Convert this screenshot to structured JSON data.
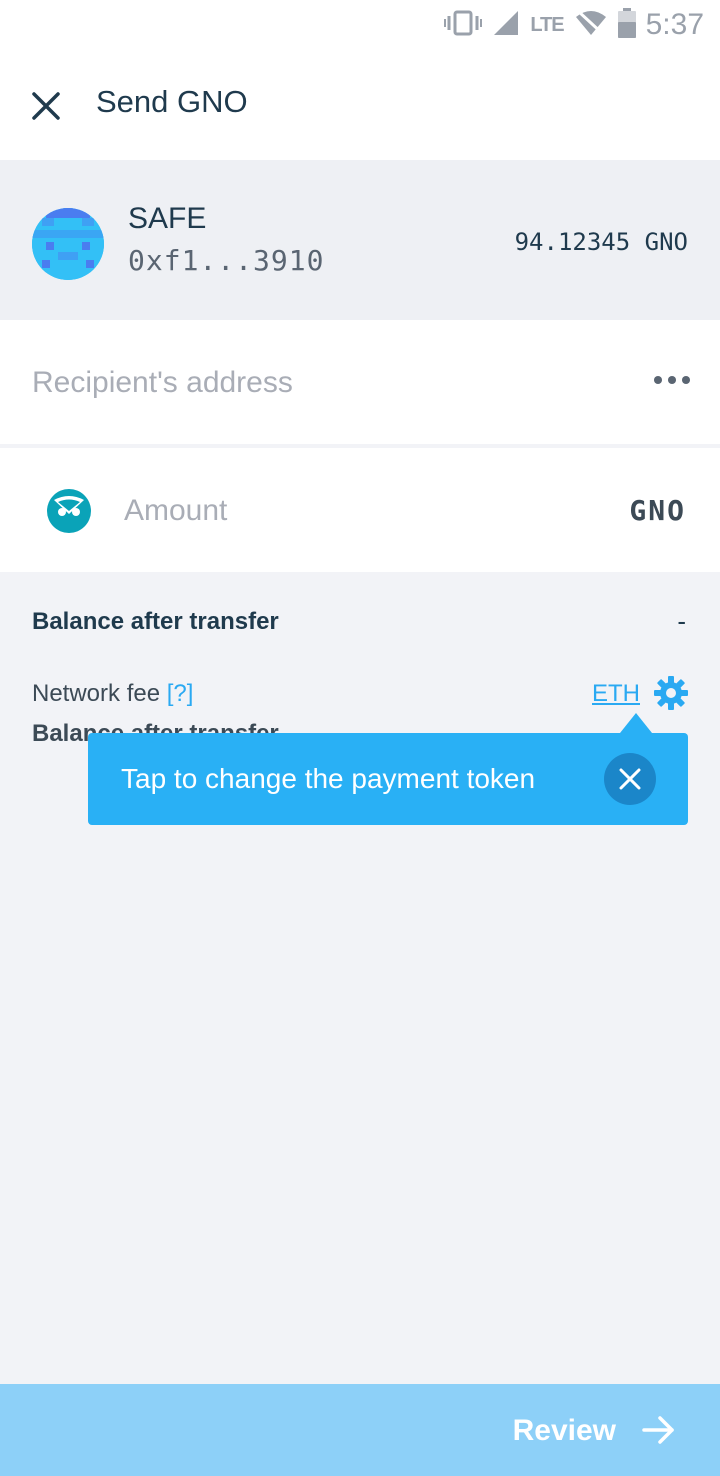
{
  "status_bar": {
    "time": "5:37",
    "network": "LTE",
    "icons": [
      "vibrate-icon",
      "signal-icon",
      "wifi-off-icon",
      "battery-icon"
    ]
  },
  "toolbar": {
    "title": "Send GNO",
    "close_icon": "close-icon"
  },
  "safe": {
    "name": "SAFE",
    "address": "0xf1...3910",
    "balance": "94.12345 GNO"
  },
  "recipient": {
    "placeholder": "Recipient's address",
    "more_icon": "more-horizontal-icon"
  },
  "amount": {
    "placeholder": "Amount",
    "unit": "GNO",
    "token_icon": "gnosis-token-icon"
  },
  "summary": {
    "balance_label": "Balance after transfer",
    "balance_value": "-",
    "fee_label": "Network fee",
    "fee_help": "[?]",
    "fee_token": "ETH",
    "settings_icon": "gear-icon",
    "balance_label_2": "Balance after transfer"
  },
  "tooltip": {
    "text": "Tap to change the payment token",
    "close_icon": "close-icon"
  },
  "review": {
    "label": "Review",
    "arrow_icon": "arrow-right-icon"
  },
  "colors": {
    "accent": "#29b0f5",
    "review_disabled": "#8dd0f8",
    "text_primary": "#1f3a4d",
    "placeholder": "#a9adb6",
    "background": "#f2f3f7"
  }
}
